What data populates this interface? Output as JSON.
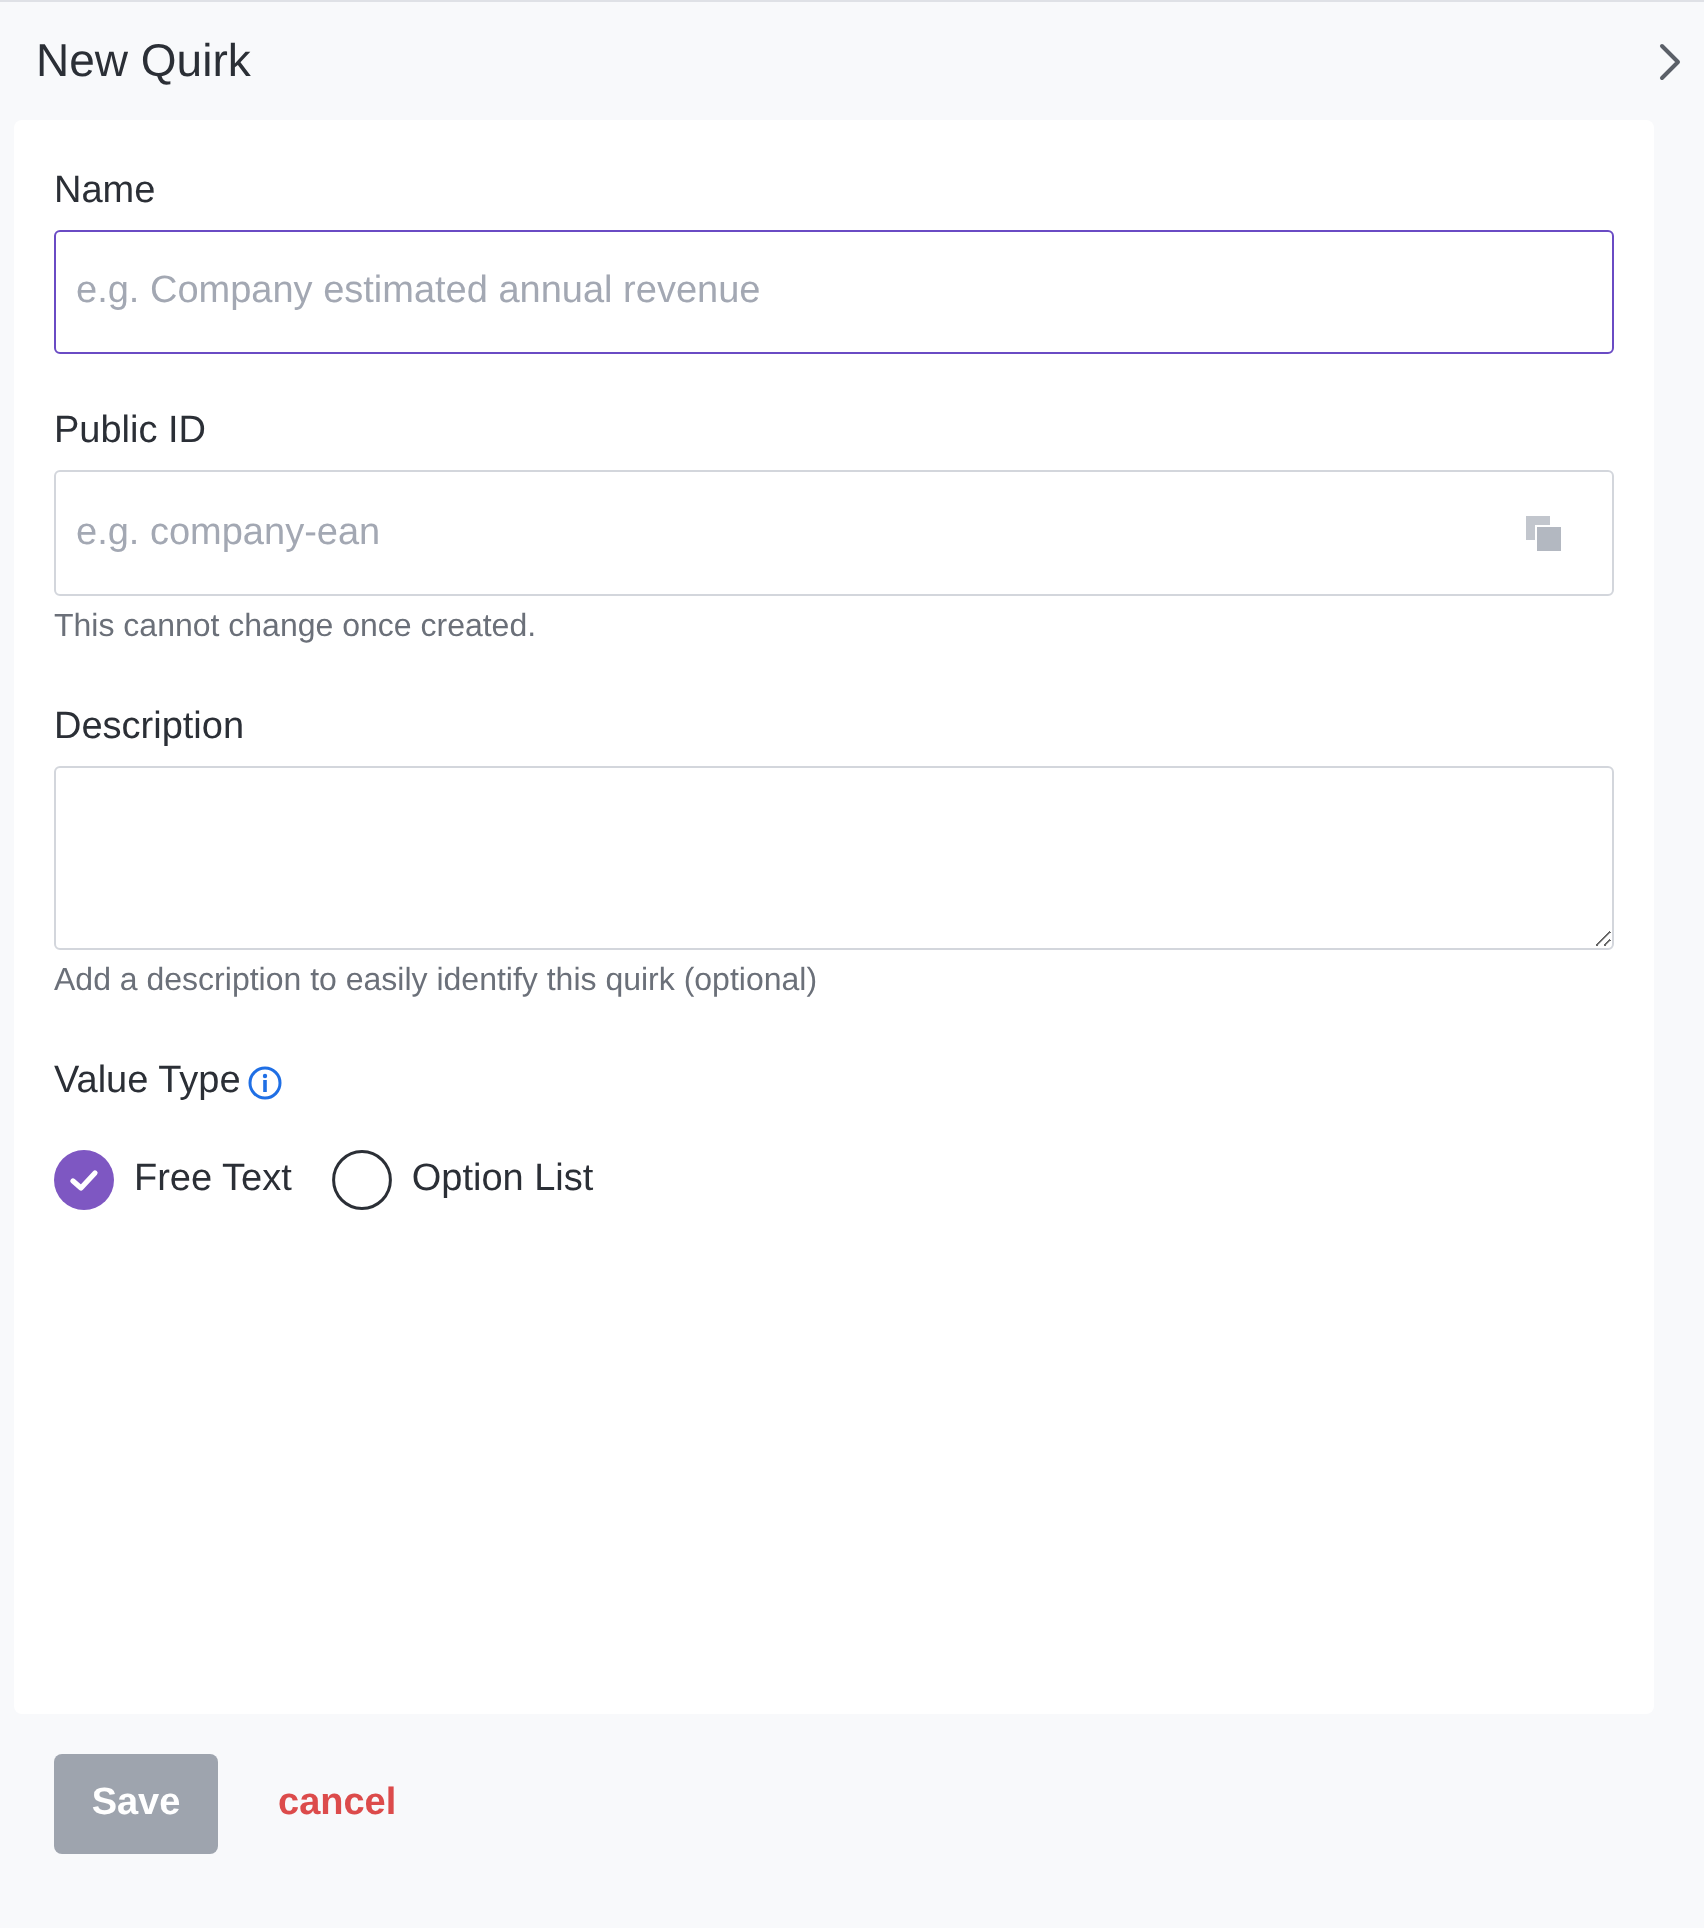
{
  "header": {
    "title": "New Quirk"
  },
  "form": {
    "fields": [
      {
        "kind": "input",
        "label": "Name",
        "placeholder": "e.g. Company estimated annual revenue",
        "focused": true
      },
      {
        "kind": "input",
        "label": "Public ID",
        "placeholder": "e.g. company-ean",
        "copy_button": true,
        "hint": "This cannot change once created."
      },
      {
        "kind": "textarea",
        "label": "Description",
        "hint": "Add a description to easily identify this quirk (optional)"
      }
    ],
    "value_type": {
      "label": "Value Type",
      "options": [
        {
          "label": "Free Text",
          "selected": true
        },
        {
          "label": "Option List",
          "selected": false
        }
      ]
    }
  },
  "actions": {
    "save": {
      "label": "Save",
      "disabled": true
    },
    "cancel": {
      "label": "cancel"
    }
  }
}
